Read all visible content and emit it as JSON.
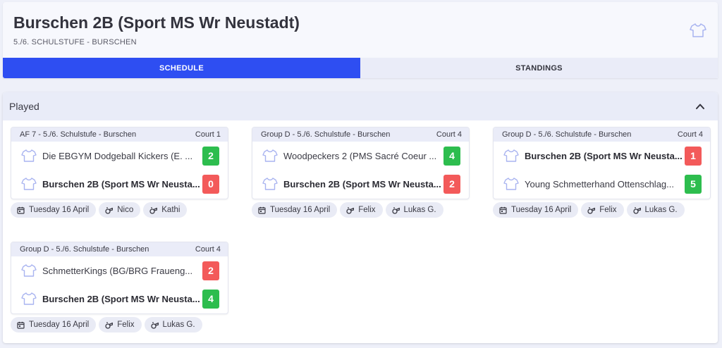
{
  "header": {
    "title": "Burschen 2B (Sport MS Wr Neustadt)",
    "subtitle": "5./6. SCHULSTUFE - BURSCHEN",
    "icon": "tshirt-icon"
  },
  "tabs": [
    {
      "label": "SCHEDULE",
      "active": true
    },
    {
      "label": "STANDINGS",
      "active": false
    }
  ],
  "section": {
    "title": "Played",
    "icon": "chevron-up-icon"
  },
  "colors": {
    "accent": "#2e4ef2",
    "win": "#2dbd4e",
    "loss": "#f35a5a"
  },
  "matches": [
    {
      "group": "AF 7 - 5./6. Schulstufe - Burschen",
      "court": "Court 1",
      "home": {
        "name": "Die EBGYM Dodgeball Kickers (E. ...",
        "score": "2",
        "result": "win",
        "bold": false
      },
      "away": {
        "name": "Burschen 2B (Sport MS Wr Neusta...",
        "score": "0",
        "result": "loss",
        "bold": true
      },
      "date": "Tuesday 16 April",
      "refs": [
        "Nico",
        "Kathi"
      ]
    },
    {
      "group": "Group D - 5./6. Schulstufe - Burschen",
      "court": "Court 4",
      "home": {
        "name": "Woodpeckers 2 (PMS Sacré Coeur ...",
        "score": "4",
        "result": "win",
        "bold": false
      },
      "away": {
        "name": "Burschen 2B (Sport MS Wr Neusta...",
        "score": "2",
        "result": "loss",
        "bold": true
      },
      "date": "Tuesday 16 April",
      "refs": [
        "Felix",
        "Lukas G."
      ]
    },
    {
      "group": "Group D - 5./6. Schulstufe - Burschen",
      "court": "Court 4",
      "home": {
        "name": "Burschen 2B (Sport MS Wr Neusta...",
        "score": "1",
        "result": "loss",
        "bold": true
      },
      "away": {
        "name": "Young Schmetterhand Ottenschlag...",
        "score": "5",
        "result": "win",
        "bold": false
      },
      "date": "Tuesday 16 April",
      "refs": [
        "Felix",
        "Lukas G."
      ]
    },
    {
      "group": "Group D - 5./6. Schulstufe - Burschen",
      "court": "Court 4",
      "home": {
        "name": "SchmetterKings (BG/BRG Fraueng...",
        "score": "2",
        "result": "loss",
        "bold": false
      },
      "away": {
        "name": "Burschen 2B (Sport MS Wr Neusta...",
        "score": "4",
        "result": "win",
        "bold": true
      },
      "date": "Tuesday 16 April",
      "refs": [
        "Felix",
        "Lukas G."
      ]
    }
  ]
}
